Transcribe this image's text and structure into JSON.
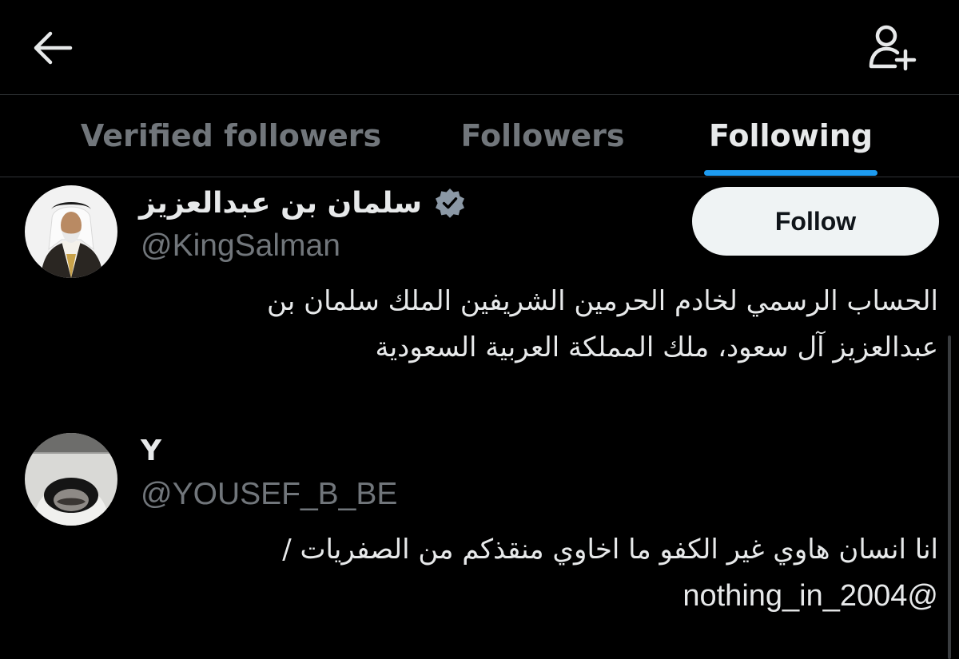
{
  "header": {
    "back_icon": "arrow-left-icon",
    "add_user_icon": "person-plus-icon"
  },
  "tabs": [
    {
      "label": "Verified followers",
      "active": false
    },
    {
      "label": "Followers",
      "active": false
    },
    {
      "label": "Following",
      "active": true
    }
  ],
  "accent_color": "#1d9bf0",
  "users": [
    {
      "name": "سلمان بن عبدالعزيز",
      "handle": "@KingSalman",
      "verified": true,
      "follow_label": "Follow",
      "bio_lines": [
        "الحساب الرسمي لخادم الحرمين الشريفين الملك سلمان بن",
        "عبدالعزيز آل سعود، ملك المملكة العربية السعودية"
      ]
    },
    {
      "name": "Y",
      "handle": "@YOUSEF_B_BE",
      "verified": false,
      "bio_lines": [
        "انا انسان هاوي غير الكفو ما اخاوي منقذكم من الصفريات /",
        "@nothing_in_2004"
      ]
    }
  ]
}
